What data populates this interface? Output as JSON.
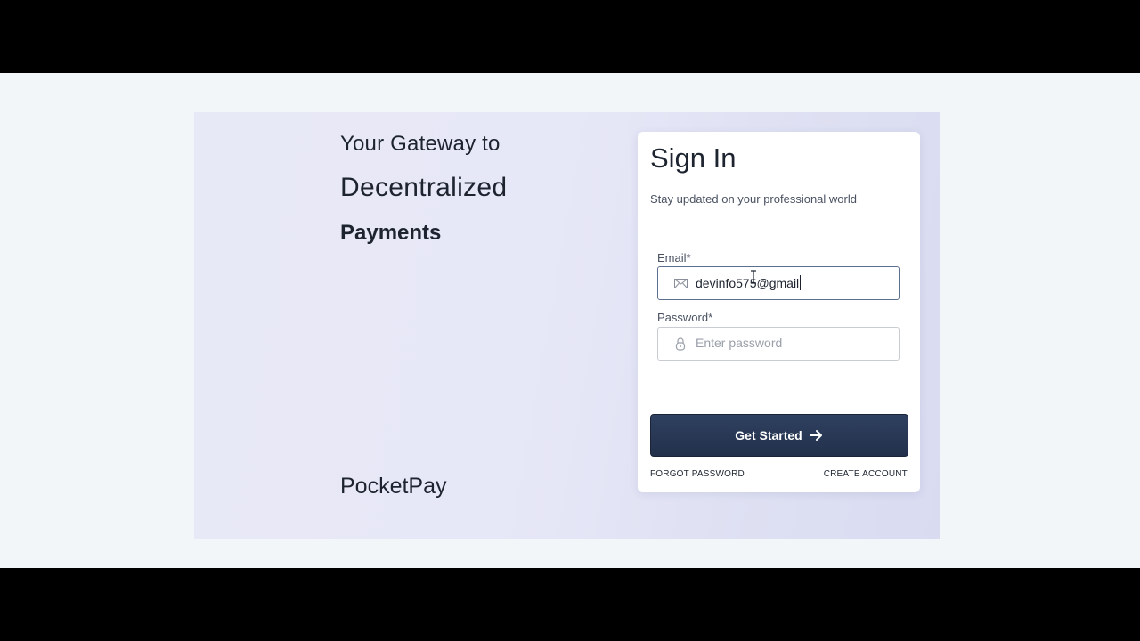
{
  "hero": {
    "tagline_line1": "Your Gateway to",
    "tagline_line2": "Decentralized",
    "tagline_line3": "Payments",
    "brand": "PocketPay"
  },
  "signin": {
    "title": "Sign In",
    "subtitle": "Stay updated on your professional world",
    "email_label": "Email*",
    "email_value": "devinfo575@gmail",
    "email_icon": "mail-icon",
    "password_label": "Password*",
    "password_placeholder": "Enter password",
    "password_icon": "lock-icon",
    "submit_label": "Get Started",
    "submit_icon": "arrow-right-icon",
    "forgot_label": "FORGOT PASSWORD",
    "create_label": "CREATE ACCOUNT"
  },
  "colors": {
    "button_bg": "#2a3a57",
    "text_primary": "#1d2430",
    "hero_bg": "#e6e7f6"
  }
}
